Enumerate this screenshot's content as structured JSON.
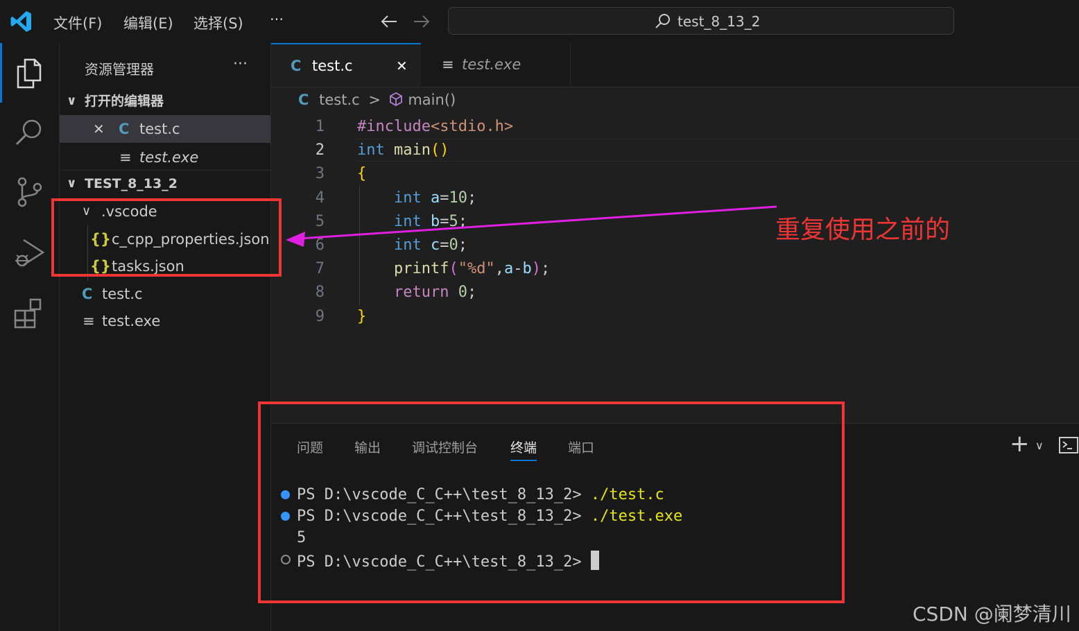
{
  "titlebar": {
    "menu": [
      "文件(F)",
      "编辑(E)",
      "选择(S)",
      "···"
    ],
    "search_text": "test_8_13_2"
  },
  "sidebar": {
    "title": "资源管理器",
    "more": "···",
    "open_editors": {
      "header": "打开的编辑器",
      "items": [
        {
          "icon": "C",
          "label": "test.c",
          "close": "✕"
        },
        {
          "icon": "≡",
          "label": "test.exe"
        }
      ]
    },
    "workspace": {
      "header": "TEST_8_13_2",
      "folder": ".vscode",
      "folder_items": [
        {
          "icon": "{}",
          "label": "c_cpp_properties.json"
        },
        {
          "icon": "{}",
          "label": "tasks.json"
        }
      ],
      "files": [
        {
          "icon": "C",
          "label": "test.c"
        },
        {
          "icon": "≡",
          "label": "test.exe"
        }
      ]
    }
  },
  "editor": {
    "tabs": [
      {
        "icon": "C",
        "label": "test.c",
        "close": "✕"
      },
      {
        "icon": "≡",
        "label": "test.exe"
      }
    ],
    "breadcrumb": {
      "file_icon": "C",
      "file": "test.c",
      "sep": ">",
      "symbol": "main()"
    },
    "line_numbers": [
      "1",
      "2",
      "3",
      "4",
      "5",
      "6",
      "7",
      "8",
      "9"
    ],
    "code": {
      "l1_pre": "#include",
      "l1_hdr": "<stdio.h>",
      "l2_kw": "int",
      "l2_fn": "main",
      "l2_paren": "()",
      "l3": "{",
      "l4_kw": "int",
      "l4_var": "a",
      "l4_eq": "=",
      "l4_num": "10",
      "l4_end": ";",
      "l5_kw": "int",
      "l5_var": "b",
      "l5_eq": "=",
      "l5_num": "5",
      "l5_end": ";",
      "l6_kw": "int",
      "l6_var": "c",
      "l6_eq": "=",
      "l6_num": "0",
      "l6_end": ";",
      "l7_fn": "printf",
      "l7_open": "(",
      "l7_str": "\"%d\"",
      "l7_comma": ",",
      "l7_a": "a",
      "l7_minus": "-",
      "l7_b": "b",
      "l7_close": ")",
      "l7_end": ";",
      "l8_kw": "return",
      "l8_num": "0",
      "l8_end": ";",
      "l9": "}"
    }
  },
  "panel": {
    "tabs": [
      "问题",
      "输出",
      "调试控制台",
      "终端",
      "端口"
    ],
    "active_tab": "终端",
    "add": "+",
    "chevron": "∨",
    "terminal": {
      "prompt": "PS D:\\vscode_C_C++\\test_8_13_2> ",
      "cmd1": "./test.c",
      "cmd2": "./test.exe",
      "output": "5"
    }
  },
  "annotation": {
    "text": "重复使用之前的",
    "color": "#ee3535",
    "arrow_color": "#e020e0"
  },
  "watermark": "CSDN @阑梦清川",
  "colors": {
    "accent": "#0078d4",
    "vscode_blue": "#23a9f2"
  }
}
